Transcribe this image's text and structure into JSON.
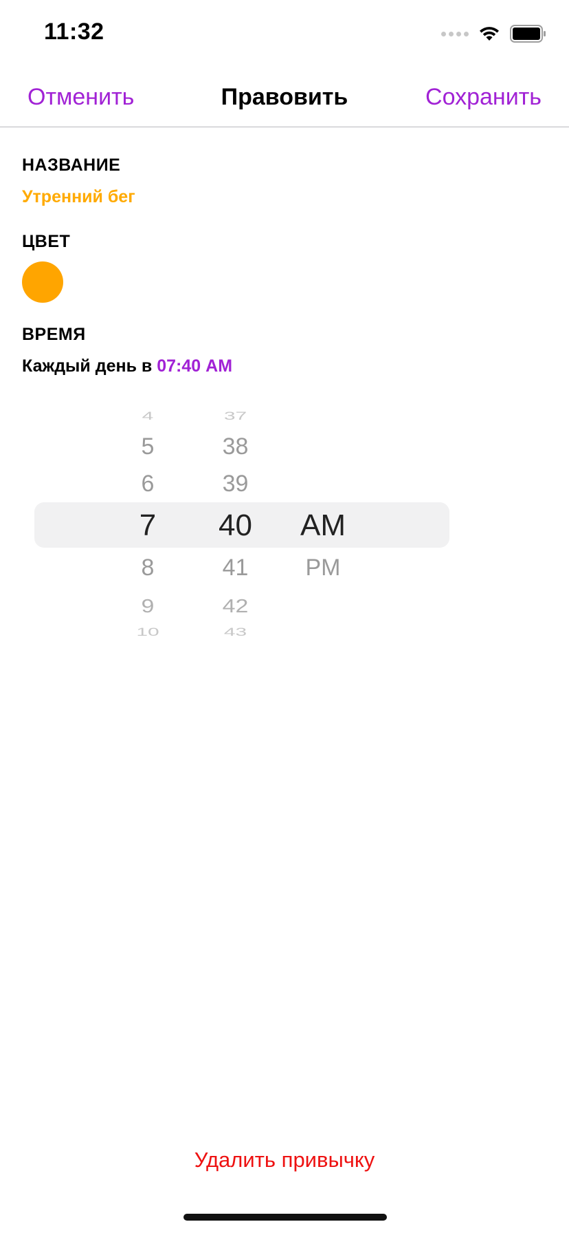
{
  "status_bar": {
    "time": "11:32",
    "signal_icon": "signal-dots-icon",
    "wifi_icon": "wifi-icon",
    "battery_icon": "battery-icon",
    "battery_level": 0.9
  },
  "nav": {
    "cancel_label": "Отменить",
    "title": "Правовить",
    "save_label": "Сохранить",
    "accent_color": "#a122d5"
  },
  "form": {
    "name_label": "НАЗВАНИЕ",
    "name_value": "Утренний бег",
    "name_color": "#ffaa00",
    "color_label": "ЦВЕТ",
    "color_value": "#ffa500",
    "time_label": "ВРЕМЯ",
    "time_prefix": "Каждый день в",
    "time_value": "07:40 AM"
  },
  "time_picker": {
    "hours": [
      "4",
      "5",
      "6",
      "7",
      "8",
      "9",
      "10"
    ],
    "minutes": [
      "37",
      "38",
      "39",
      "40",
      "41",
      "42",
      "43"
    ],
    "periods": [
      "AM",
      "PM"
    ],
    "selected_hour": "7",
    "selected_minute": "40",
    "selected_period": "AM"
  },
  "footer": {
    "delete_label": "Удалить привычку",
    "delete_color": "#ee1111"
  }
}
